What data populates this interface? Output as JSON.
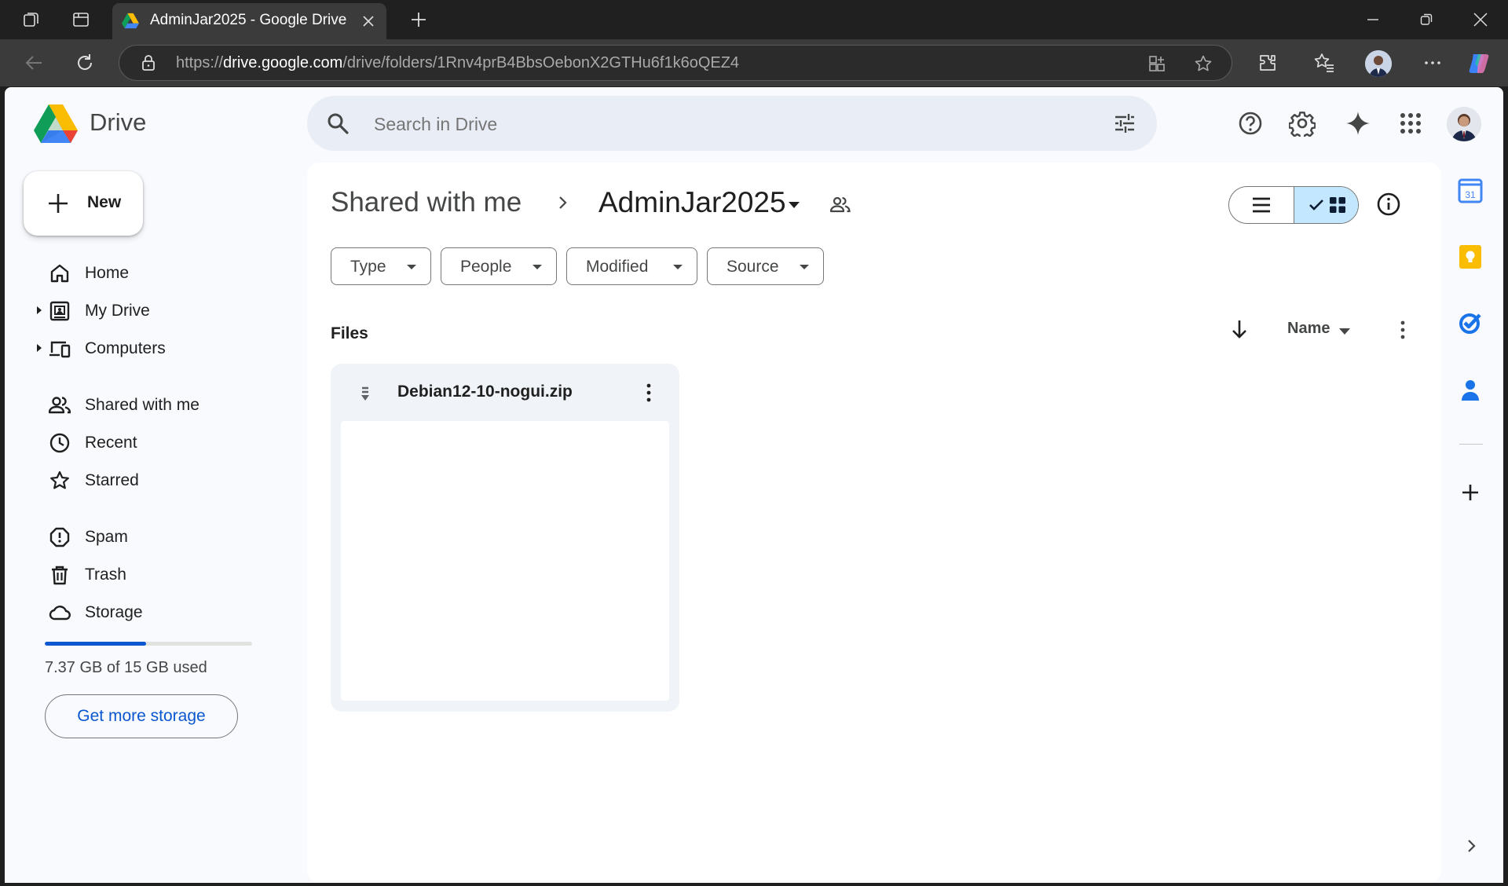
{
  "browser": {
    "tab_title": "AdminJar2025 - Google Drive",
    "url_prefix": "https://",
    "url_host": "drive.google.com",
    "url_path": "/drive/folders/1Rnv4prB4BbsOebonX2GTHu6f1k6oQEZ4"
  },
  "header": {
    "logo_text": "Drive",
    "search_placeholder": "Search in Drive"
  },
  "sidebar": {
    "new_label": "New",
    "items": [
      {
        "label": "Home",
        "icon": "home-icon"
      },
      {
        "label": "My Drive",
        "icon": "my-drive-icon"
      },
      {
        "label": "Computers",
        "icon": "computers-icon"
      },
      {
        "label": "Shared with me",
        "icon": "shared-icon"
      },
      {
        "label": "Recent",
        "icon": "clock-icon"
      },
      {
        "label": "Starred",
        "icon": "star-icon"
      },
      {
        "label": "Spam",
        "icon": "spam-icon"
      },
      {
        "label": "Trash",
        "icon": "trash-icon"
      },
      {
        "label": "Storage",
        "icon": "cloud-icon"
      }
    ],
    "storage": {
      "used_fraction": 0.49,
      "text": "7.37 GB of 15 GB used",
      "button_label": "Get more storage"
    }
  },
  "main": {
    "breadcrumb_parent": "Shared with me",
    "breadcrumb_current": "AdminJar2025",
    "filters": [
      "Type",
      "People",
      "Modified",
      "Source"
    ],
    "section_label": "Files",
    "sort_label": "Name",
    "files": [
      {
        "name": "Debian12-10-nogui.zip",
        "type": "zip"
      }
    ]
  },
  "colors": {
    "accent": "#0b57d0",
    "selected_toggle": "#c2e7ff",
    "page_bg": "#f8fafd"
  }
}
